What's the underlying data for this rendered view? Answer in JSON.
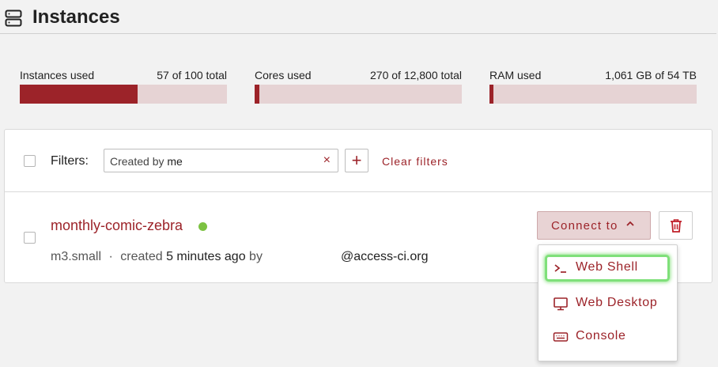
{
  "header": {
    "title": "Instances",
    "icon": "server-icon"
  },
  "usage": [
    {
      "label": "Instances used",
      "value": "57 of 100 total",
      "fraction": 0.57
    },
    {
      "label": "Cores used",
      "value": "270 of 12,800 total",
      "fraction": 0.021
    },
    {
      "label": "RAM used",
      "value": "1,061 GB of 54 TB",
      "fraction": 0.019
    }
  ],
  "colors": {
    "accent": "#9c2329",
    "bar_bg": "#e6d3d4",
    "status_active": "#7cc242",
    "focus_ring": "#7fe07a"
  },
  "filters": {
    "label": "Filters:",
    "chip_key": "Created by",
    "chip_value": "me",
    "chip_remove": "×",
    "add_symbol": "+",
    "clear_label": "Clear filters"
  },
  "instance": {
    "name": "monthly-comic-zebra",
    "flavor": "m3.small",
    "separator": "·",
    "created_prefix": "created",
    "created_time": "5 minutes ago",
    "by": "by",
    "owner": "@access-ci.org",
    "connect_label": "Connect to",
    "connect_chevron": "^"
  },
  "connect_menu": [
    {
      "label": "Web Shell",
      "icon": "terminal-icon",
      "highlighted": true
    },
    {
      "label": "Web Desktop",
      "icon": "monitor-icon",
      "highlighted": false
    },
    {
      "label": "Console",
      "icon": "keyboard-icon",
      "highlighted": false
    }
  ]
}
